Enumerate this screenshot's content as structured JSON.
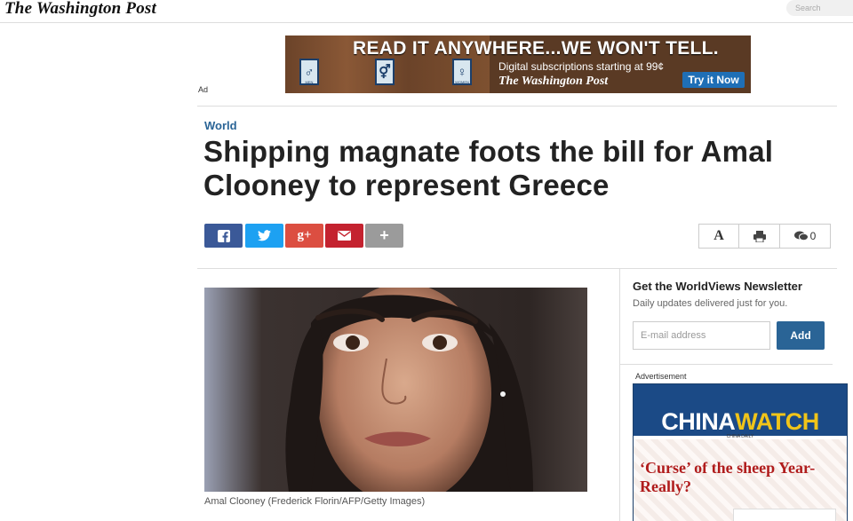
{
  "header": {
    "logo": "The Washington Post",
    "search_placeholder": "Search"
  },
  "banner_ad": {
    "headline": "READ IT ANYWHERE...WE WON'T TELL.",
    "subline": "Digital subscriptions starting at 99¢",
    "brand": "The Washington Post",
    "cta": "Try it Now",
    "door_labels": [
      "MEN",
      "",
      "WOMEN"
    ],
    "label": "Ad"
  },
  "article": {
    "section": "World",
    "title": "Shipping magnate foots the bill for Amal Clooney to represent Greece",
    "share": {
      "facebook": "f",
      "twitter": "t",
      "googleplus": "g+",
      "email": "email",
      "more": "+"
    },
    "tools": {
      "font": "A",
      "comments_count": "0"
    },
    "photo_caption": "Amal Clooney (Frederick Florin/AFP/Getty Images)"
  },
  "newsletter": {
    "title": "Get the WorldViews Newsletter",
    "subtitle": "Daily updates delivered just for you.",
    "input_placeholder": "E-mail address",
    "button": "Add"
  },
  "side_ad": {
    "label": "Advertisement",
    "brand_left": "CHINA",
    "brand_right": "WATCH",
    "brand_sub": "CHINA DAILY",
    "story": "‘Curse’ of the sheep Year- Really?"
  },
  "colors": {
    "accent": "#2a6496",
    "facebook": "#3b5998",
    "twitter": "#1da1f2",
    "googleplus": "#dc4e41",
    "email": "#c4222f",
    "more": "#9b9b9b"
  }
}
